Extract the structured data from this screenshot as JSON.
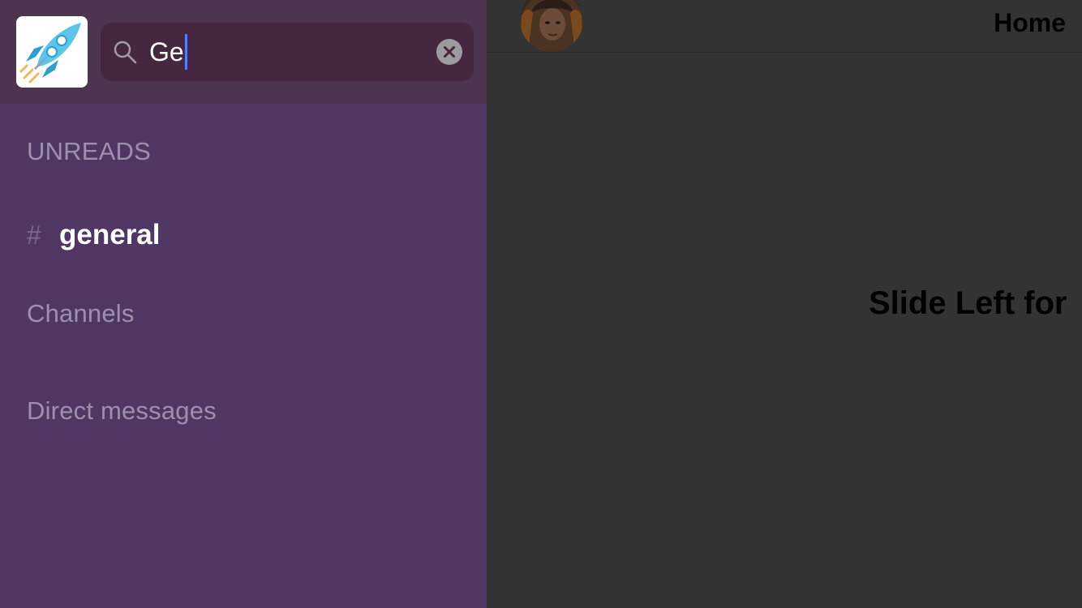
{
  "sidebar": {
    "logo_icon": "rocket-icon",
    "search": {
      "value": "Ge",
      "icon": "search-icon",
      "clear_icon": "clear-icon"
    },
    "sections": {
      "unreads": "UNREADS",
      "channels": "Channels",
      "direct_messages": "Direct messages"
    },
    "unread_channels": [
      {
        "prefix": "#",
        "name": "general"
      }
    ]
  },
  "main": {
    "title": "Home",
    "hint": "Slide Left for",
    "avatar_icon": "user-avatar"
  },
  "colors": {
    "sidebar_bg": "#4f3663",
    "header_bg": "#4d3550",
    "search_bg": "#45283f",
    "caret": "#5b7cf7",
    "main_bg": "#333333"
  }
}
